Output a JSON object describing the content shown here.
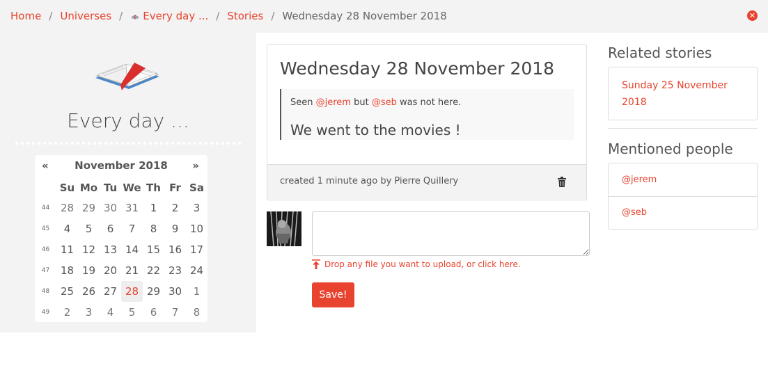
{
  "breadcrumb": {
    "home": "Home",
    "universes": "Universes",
    "universe": "Every day ...",
    "stories": "Stories",
    "current": "Wednesday 28 November 2018",
    "separator": "/"
  },
  "icons": {
    "close": "close-circle-icon",
    "book": "book-icon",
    "trash": "trash-icon",
    "upload": "upload-arrow-icon"
  },
  "colors": {
    "accent": "#e8432e",
    "panel": "#f3f3f3"
  },
  "universe": {
    "title": "Every day ..."
  },
  "calendar": {
    "prev": "«",
    "next": "»",
    "month": "November 2018",
    "weekdays": [
      "Su",
      "Mo",
      "Tu",
      "We",
      "Th",
      "Fr",
      "Sa"
    ],
    "weeks": [
      {
        "num": "44",
        "days": [
          "28",
          "29",
          "30",
          "31",
          "1",
          "2",
          "3"
        ]
      },
      {
        "num": "45",
        "days": [
          "4",
          "5",
          "6",
          "7",
          "8",
          "9",
          "10"
        ]
      },
      {
        "num": "46",
        "days": [
          "11",
          "12",
          "13",
          "14",
          "15",
          "16",
          "17"
        ]
      },
      {
        "num": "47",
        "days": [
          "18",
          "19",
          "20",
          "21",
          "22",
          "23",
          "24"
        ]
      },
      {
        "num": "48",
        "days": [
          "25",
          "26",
          "27",
          "28",
          "29",
          "30",
          "1"
        ]
      },
      {
        "num": "49",
        "days": [
          "2",
          "3",
          "4",
          "5",
          "6",
          "7",
          "8"
        ]
      }
    ],
    "selected": "28"
  },
  "story": {
    "title": "Wednesday 28 November 2018",
    "quote": {
      "pre": "Seen ",
      "mention1": "@jerem",
      "mid": " but ",
      "mention2": "@seb",
      "post": " was not here."
    },
    "heading": "We went to the movies !",
    "footer": "created 1 minute ago by Pierre Quillery"
  },
  "comment": {
    "placeholder": "",
    "upload_text": "Drop any file you want to upload, or click here.",
    "save_label": "Save!"
  },
  "related": {
    "title": "Related stories",
    "items": [
      "Sunday 25 November 2018"
    ]
  },
  "mentioned": {
    "title": "Mentioned people",
    "items": [
      "@jerem",
      "@seb"
    ]
  }
}
